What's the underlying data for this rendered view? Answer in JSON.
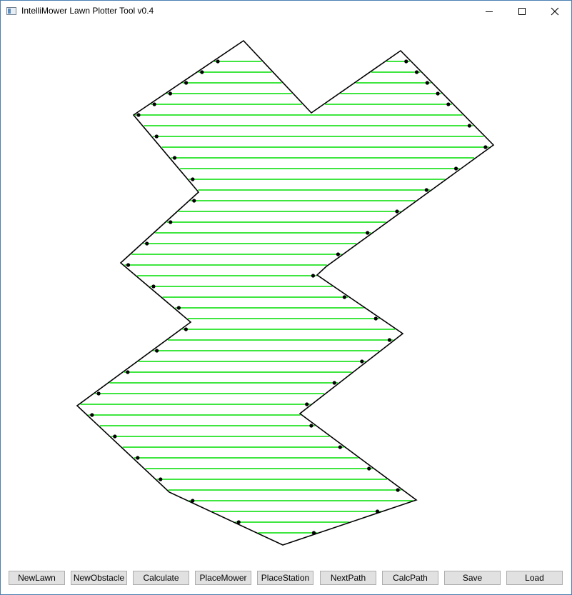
{
  "window": {
    "title": "IntelliMower Lawn Plotter Tool v0.4",
    "controls": {
      "minimize": "minimize-icon",
      "maximize": "maximize-icon",
      "close": "close-icon"
    }
  },
  "toolbar": {
    "buttons": [
      {
        "id": "new-lawn",
        "label": "NewLawn"
      },
      {
        "id": "new-obstacle",
        "label": "NewObstacle"
      },
      {
        "id": "calculate",
        "label": "Calculate"
      },
      {
        "id": "place-mower",
        "label": "PlaceMower"
      },
      {
        "id": "place-station",
        "label": "PlaceStation"
      },
      {
        "id": "next-path",
        "label": "NextPath"
      },
      {
        "id": "calc-path",
        "label": "CalcPath"
      },
      {
        "id": "save",
        "label": "Save"
      },
      {
        "id": "load",
        "label": "Load"
      }
    ]
  },
  "colors": {
    "boundary": "#000000",
    "mow_path": "#00dd00",
    "vertex_dot": "#000000",
    "button_face": "#e1e1e1",
    "button_border": "#adadad"
  }
}
